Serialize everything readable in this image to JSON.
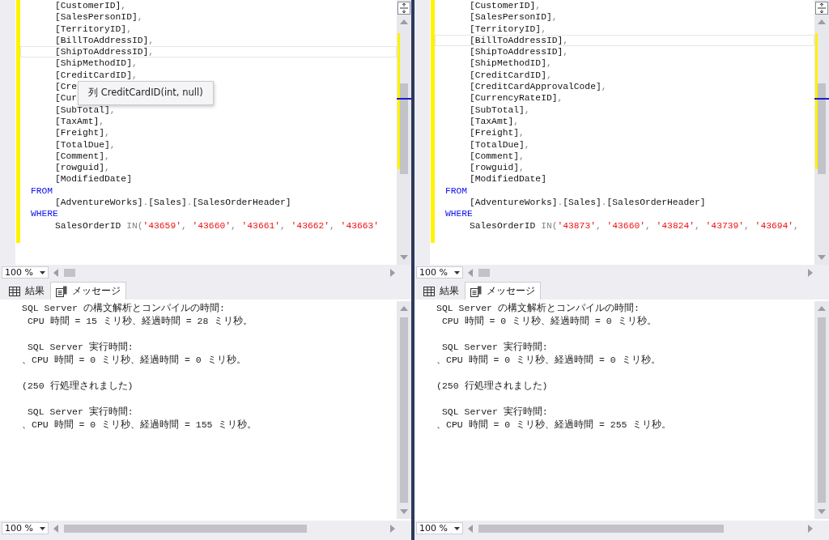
{
  "panes": [
    {
      "code": [
        {
          "indent": true,
          "current": false,
          "parts": [
            {
              "kind": "plain",
              "text": "[CustomerID]"
            },
            {
              "kind": "gray",
              "text": ","
            }
          ]
        },
        {
          "indent": true,
          "current": false,
          "parts": [
            {
              "kind": "plain",
              "text": "[SalesPersonID]"
            },
            {
              "kind": "gray",
              "text": ","
            }
          ]
        },
        {
          "indent": true,
          "current": false,
          "parts": [
            {
              "kind": "plain",
              "text": "[TerritoryID]"
            },
            {
              "kind": "gray",
              "text": ","
            }
          ]
        },
        {
          "indent": true,
          "current": false,
          "parts": [
            {
              "kind": "plain",
              "text": "[BillToAddressID]"
            },
            {
              "kind": "gray",
              "text": ","
            }
          ]
        },
        {
          "indent": true,
          "current": true,
          "parts": [
            {
              "kind": "plain",
              "text": "[ShipToAddressID]"
            },
            {
              "kind": "gray",
              "text": ","
            }
          ]
        },
        {
          "indent": true,
          "current": false,
          "parts": [
            {
              "kind": "plain",
              "text": "[ShipMethodID]"
            },
            {
              "kind": "gray",
              "text": ","
            }
          ]
        },
        {
          "indent": true,
          "current": false,
          "parts": [
            {
              "kind": "plain",
              "text": "[CreditCardID]"
            },
            {
              "kind": "gray",
              "text": ","
            }
          ]
        },
        {
          "indent": true,
          "current": false,
          "parts": [
            {
              "kind": "plain",
              "text": "[Cre"
            }
          ]
        },
        {
          "indent": true,
          "current": false,
          "parts": [
            {
              "kind": "plain",
              "text": "[Cur"
            }
          ]
        },
        {
          "indent": true,
          "current": false,
          "parts": [
            {
              "kind": "plain",
              "text": "[SubTotal]"
            },
            {
              "kind": "gray",
              "text": ","
            }
          ]
        },
        {
          "indent": true,
          "current": false,
          "parts": [
            {
              "kind": "plain",
              "text": "[TaxAmt]"
            },
            {
              "kind": "gray",
              "text": ","
            }
          ]
        },
        {
          "indent": true,
          "current": false,
          "parts": [
            {
              "kind": "plain",
              "text": "[Freight]"
            },
            {
              "kind": "gray",
              "text": ","
            }
          ]
        },
        {
          "indent": true,
          "current": false,
          "parts": [
            {
              "kind": "plain",
              "text": "[TotalDue]"
            },
            {
              "kind": "gray",
              "text": ","
            }
          ]
        },
        {
          "indent": true,
          "current": false,
          "parts": [
            {
              "kind": "plain",
              "text": "[Comment]"
            },
            {
              "kind": "gray",
              "text": ","
            }
          ]
        },
        {
          "indent": true,
          "current": false,
          "parts": [
            {
              "kind": "plain",
              "text": "[rowguid]"
            },
            {
              "kind": "gray",
              "text": ","
            }
          ]
        },
        {
          "indent": true,
          "current": false,
          "parts": [
            {
              "kind": "plain",
              "text": "[ModifiedDate]"
            }
          ]
        },
        {
          "indent": false,
          "current": false,
          "parts": [
            {
              "kind": "keyword",
              "text": "FROM"
            }
          ]
        },
        {
          "indent": true,
          "current": false,
          "parts": [
            {
              "kind": "plain",
              "text": "[AdventureWorks]"
            },
            {
              "kind": "gray",
              "text": "."
            },
            {
              "kind": "plain",
              "text": "[Sales]"
            },
            {
              "kind": "gray",
              "text": "."
            },
            {
              "kind": "plain",
              "text": "[SalesOrderHeader]"
            }
          ]
        },
        {
          "indent": false,
          "current": false,
          "parts": [
            {
              "kind": "keyword",
              "text": "WHERE"
            }
          ]
        },
        {
          "indent": true,
          "current": false,
          "parts": [
            {
              "kind": "plain",
              "text": "SalesOrderID "
            },
            {
              "kind": "gray",
              "text": "IN("
            },
            {
              "kind": "string",
              "text": "'43659'"
            },
            {
              "kind": "gray",
              "text": ", "
            },
            {
              "kind": "string",
              "text": "'43660'"
            },
            {
              "kind": "gray",
              "text": ", "
            },
            {
              "kind": "string",
              "text": "'43661'"
            },
            {
              "kind": "gray",
              "text": ", "
            },
            {
              "kind": "string",
              "text": "'43662'"
            },
            {
              "kind": "gray",
              "text": ", "
            },
            {
              "kind": "string",
              "text": "'43663'"
            }
          ]
        }
      ],
      "tooltip": "列 CreditCardID(int, null)",
      "editor_zoom": "100 %",
      "tabs": [
        {
          "label": "結果",
          "kind": "grid",
          "selected": false
        },
        {
          "label": "メッセージ",
          "kind": "document",
          "selected": true
        }
      ],
      "messages": [
        [
          "SQL Server の構文解析とコンパイルの時間:",
          " CPU 時間 = 15 ミリ秒、経過時間 = 28 ミリ秒。"
        ],
        [
          " SQL Server 実行時間:",
          "、CPU 時間 = 0 ミリ秒、経過時間 = 0 ミリ秒。"
        ],
        [
          "(250 行処理されました)"
        ],
        [
          " SQL Server 実行時間:",
          "、CPU 時間 = 0 ミリ秒、経過時間 = 155 ミリ秒。"
        ]
      ],
      "messages_zoom": "100 %"
    },
    {
      "code": [
        {
          "indent": true,
          "current": false,
          "parts": [
            {
              "kind": "plain",
              "text": "[CustomerID]"
            },
            {
              "kind": "gray",
              "text": ","
            }
          ]
        },
        {
          "indent": true,
          "current": false,
          "parts": [
            {
              "kind": "plain",
              "text": "[SalesPersonID]"
            },
            {
              "kind": "gray",
              "text": ","
            }
          ]
        },
        {
          "indent": true,
          "current": false,
          "parts": [
            {
              "kind": "plain",
              "text": "[TerritoryID]"
            },
            {
              "kind": "gray",
              "text": ","
            }
          ]
        },
        {
          "indent": true,
          "current": true,
          "parts": [
            {
              "kind": "plain",
              "text": "[BillToAddressID]"
            },
            {
              "kind": "gray",
              "text": ","
            }
          ]
        },
        {
          "indent": true,
          "current": false,
          "parts": [
            {
              "kind": "plain",
              "text": "[ShipToAddressID]"
            },
            {
              "kind": "gray",
              "text": ","
            }
          ]
        },
        {
          "indent": true,
          "current": false,
          "parts": [
            {
              "kind": "plain",
              "text": "[ShipMethodID]"
            },
            {
              "kind": "gray",
              "text": ","
            }
          ]
        },
        {
          "indent": true,
          "current": false,
          "parts": [
            {
              "kind": "plain",
              "text": "[CreditCardID]"
            },
            {
              "kind": "gray",
              "text": ","
            }
          ]
        },
        {
          "indent": true,
          "current": false,
          "parts": [
            {
              "kind": "plain",
              "text": "[CreditCardApprovalCode]"
            },
            {
              "kind": "gray",
              "text": ","
            }
          ]
        },
        {
          "indent": true,
          "current": false,
          "parts": [
            {
              "kind": "plain",
              "text": "[CurrencyRateID]"
            },
            {
              "kind": "gray",
              "text": ","
            }
          ]
        },
        {
          "indent": true,
          "current": false,
          "parts": [
            {
              "kind": "plain",
              "text": "[SubTotal]"
            },
            {
              "kind": "gray",
              "text": ","
            }
          ]
        },
        {
          "indent": true,
          "current": false,
          "parts": [
            {
              "kind": "plain",
              "text": "[TaxAmt]"
            },
            {
              "kind": "gray",
              "text": ","
            }
          ]
        },
        {
          "indent": true,
          "current": false,
          "parts": [
            {
              "kind": "plain",
              "text": "[Freight]"
            },
            {
              "kind": "gray",
              "text": ","
            }
          ]
        },
        {
          "indent": true,
          "current": false,
          "parts": [
            {
              "kind": "plain",
              "text": "[TotalDue]"
            },
            {
              "kind": "gray",
              "text": ","
            }
          ]
        },
        {
          "indent": true,
          "current": false,
          "parts": [
            {
              "kind": "plain",
              "text": "[Comment]"
            },
            {
              "kind": "gray",
              "text": ","
            }
          ]
        },
        {
          "indent": true,
          "current": false,
          "parts": [
            {
              "kind": "plain",
              "text": "[rowguid]"
            },
            {
              "kind": "gray",
              "text": ","
            }
          ]
        },
        {
          "indent": true,
          "current": false,
          "parts": [
            {
              "kind": "plain",
              "text": "[ModifiedDate]"
            }
          ]
        },
        {
          "indent": false,
          "current": false,
          "parts": [
            {
              "kind": "keyword",
              "text": "FROM"
            }
          ]
        },
        {
          "indent": true,
          "current": false,
          "parts": [
            {
              "kind": "plain",
              "text": "[AdventureWorks]"
            },
            {
              "kind": "gray",
              "text": "."
            },
            {
              "kind": "plain",
              "text": "[Sales]"
            },
            {
              "kind": "gray",
              "text": "."
            },
            {
              "kind": "plain",
              "text": "[SalesOrderHeader]"
            }
          ]
        },
        {
          "indent": false,
          "current": false,
          "parts": [
            {
              "kind": "keyword",
              "text": "WHERE"
            }
          ]
        },
        {
          "indent": true,
          "current": false,
          "parts": [
            {
              "kind": "plain",
              "text": "SalesOrderID "
            },
            {
              "kind": "gray",
              "text": "IN("
            },
            {
              "kind": "string",
              "text": "'43873'"
            },
            {
              "kind": "gray",
              "text": ", "
            },
            {
              "kind": "string",
              "text": "'43660'"
            },
            {
              "kind": "gray",
              "text": ", "
            },
            {
              "kind": "string",
              "text": "'43824'"
            },
            {
              "kind": "gray",
              "text": ", "
            },
            {
              "kind": "string",
              "text": "'43739'"
            },
            {
              "kind": "gray",
              "text": ", "
            },
            {
              "kind": "string",
              "text": "'43694'"
            },
            {
              "kind": "gray",
              "text": ","
            }
          ]
        }
      ],
      "editor_zoom": "100 %",
      "tabs": [
        {
          "label": "結果",
          "kind": "grid",
          "selected": false
        },
        {
          "label": "メッセージ",
          "kind": "document",
          "selected": true
        }
      ],
      "messages": [
        [
          "SQL Server の構文解析とコンパイルの時間:",
          " CPU 時間 = 0 ミリ秒、経過時間 = 0 ミリ秒。"
        ],
        [
          " SQL Server 実行時間:",
          "、CPU 時間 = 0 ミリ秒、経過時間 = 0 ミリ秒。"
        ],
        [
          "(250 行処理されました)"
        ],
        [
          " SQL Server 実行時間:",
          "、CPU 時間 = 0 ミリ秒、経過時間 = 255 ミリ秒。"
        ]
      ],
      "messages_zoom": "100 %"
    }
  ]
}
